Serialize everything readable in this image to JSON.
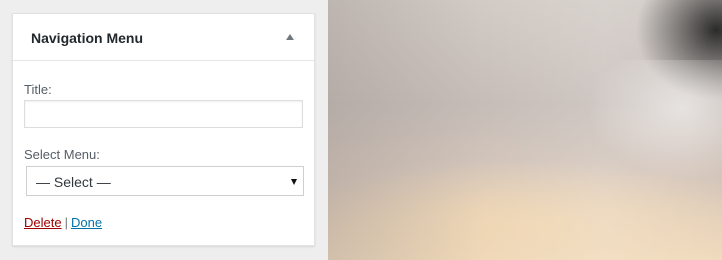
{
  "widget": {
    "title": "Navigation Menu",
    "toggle_icon": "triangle-up-icon",
    "title_field": {
      "label": "Title:",
      "value": ""
    },
    "menu_field": {
      "label": "Select Menu:",
      "selected": "— Select —"
    },
    "actions": {
      "delete_label": "Delete",
      "separator": "|",
      "done_label": "Done"
    }
  },
  "colors": {
    "background": "#eeeeee",
    "delete_link": "#a00000",
    "done_link": "#0073aa"
  }
}
